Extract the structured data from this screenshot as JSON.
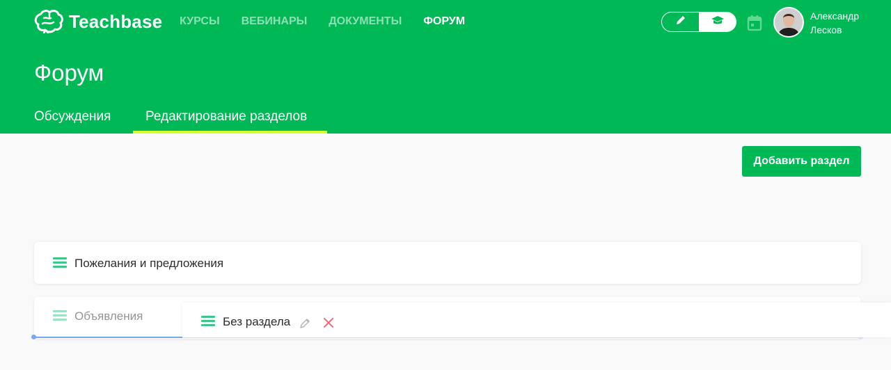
{
  "brand": {
    "name": "Teachbase",
    "logo_icon": "brain-icon"
  },
  "nav": {
    "items": [
      {
        "label": "КУРСЫ",
        "active": false
      },
      {
        "label": "ВЕБИНАРЫ",
        "active": false
      },
      {
        "label": "ДОКУМЕНТЫ",
        "active": false
      },
      {
        "label": "ФОРУМ",
        "active": true
      }
    ]
  },
  "mode_toggle": {
    "edit_icon": "pencil-icon",
    "learn_icon": "graduation-cap-icon",
    "selected": "learn"
  },
  "calendar_icon": "calendar-icon",
  "user": {
    "first_name": "Александр",
    "last_name": "Лесков"
  },
  "page": {
    "title": "Форум"
  },
  "tabs": [
    {
      "label": "Обсуждения",
      "active": false
    },
    {
      "label": "Редактирование разделов",
      "active": true
    }
  ],
  "actions": {
    "add_section_label": "Добавить раздел"
  },
  "sections": [
    {
      "label": "Пожелания и предложения"
    },
    {
      "label": "Объявления"
    }
  ],
  "dragging_section": {
    "label": "Без раздела",
    "edit_icon": "pencil-icon",
    "delete_icon": "close-icon"
  },
  "colors": {
    "brand_green": "#00b956",
    "tab_underline": "#d4ff2e",
    "handle": "#3ec68a",
    "delete": "#f06a78",
    "drop_indicator": "#7aa7f0"
  }
}
